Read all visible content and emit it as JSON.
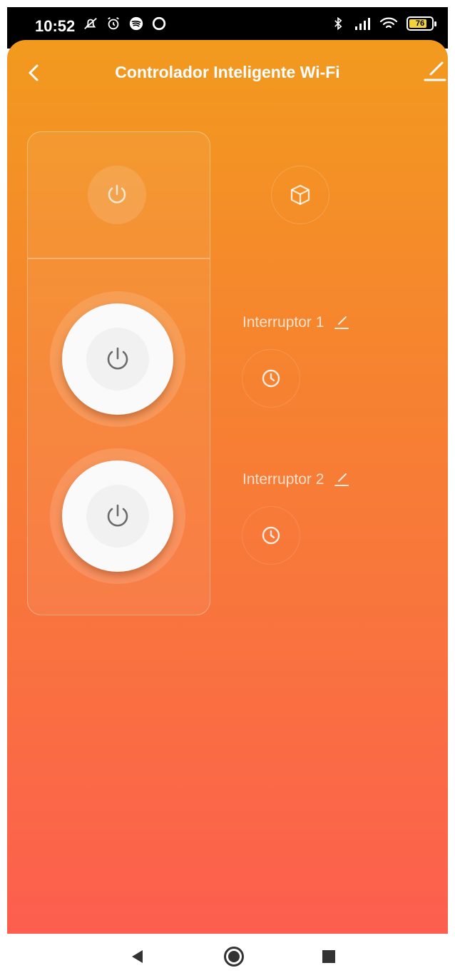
{
  "status_bar": {
    "time": "10:52",
    "battery": "76",
    "left_icons": [
      "notifications-off-icon",
      "alarm-icon",
      "spotify-icon",
      "circle-app-icon"
    ],
    "right_icons": [
      "bluetooth-icon",
      "signal-icon",
      "wifi-icon",
      "battery-icon"
    ]
  },
  "header": {
    "title": "Controlador Inteligente Wi-Fi",
    "back_icon": "chevron-left-icon",
    "edit_icon": "pencil-icon"
  },
  "controls": {
    "all_power_icon": "power-icon",
    "scene_icon": "cube-icon"
  },
  "switches": [
    {
      "label": "Interruptor 1",
      "power_icon": "power-icon",
      "timer_icon": "clock-icon",
      "edit_icon": "pencil-icon"
    },
    {
      "label": "Interruptor 2",
      "power_icon": "power-icon",
      "timer_icon": "clock-icon",
      "edit_icon": "pencil-icon"
    }
  ],
  "colors": {
    "gradient_top": "#f29a1e",
    "gradient_bottom": "#fd5e4f",
    "knob": "#fafafa"
  },
  "nav_bar": {
    "icons": [
      "back-triangle-icon",
      "home-circle-icon",
      "recents-square-icon"
    ]
  }
}
